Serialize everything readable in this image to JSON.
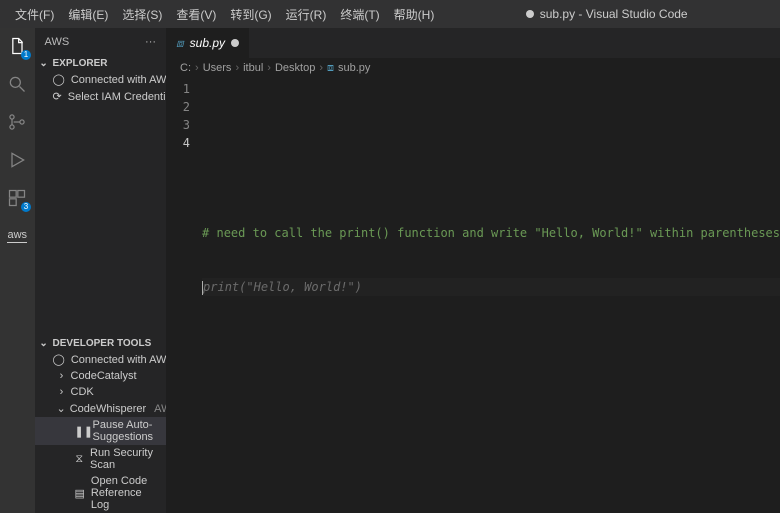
{
  "window": {
    "title": "sub.py - Visual Studio Code"
  },
  "menu": [
    "文件(F)",
    "编辑(E)",
    "选择(S)",
    "查看(V)",
    "转到(G)",
    "运行(R)",
    "终端(T)",
    "帮助(H)"
  ],
  "activitybar": {
    "explorer_badge": "1",
    "aws_badge": "3",
    "aws_label": "aws"
  },
  "sidebar": {
    "title": "AWS",
    "explorer": {
      "label": "EXPLORER",
      "items": [
        {
          "icon": "user",
          "label": "Connected with AWS Builder ID"
        },
        {
          "icon": "refresh",
          "label": "Select IAM Credentials to View Res..."
        }
      ]
    },
    "devtools": {
      "label": "DEVELOPER TOOLS",
      "connected": "Connected with AWS Builder ID",
      "children": [
        {
          "exp": ">",
          "label": "CodeCatalyst"
        },
        {
          "exp": ">",
          "label": "CDK"
        },
        {
          "exp": "v",
          "label": "CodeWhisperer",
          "suffix": "AWS Builder ID Conn..."
        }
      ],
      "cw": [
        {
          "icon": "pause",
          "label": "Pause Auto-Suggestions",
          "selected": true
        },
        {
          "icon": "scan",
          "label": "Run Security Scan"
        },
        {
          "icon": "log",
          "label": "Open Code Reference Log"
        }
      ]
    }
  },
  "tab": {
    "filename": "sub.py"
  },
  "breadcrumb": [
    "C:",
    "Users",
    "itbul",
    "Desktop",
    "sub.py"
  ],
  "editor": {
    "lines": [
      "1",
      "2",
      "3",
      "4"
    ],
    "comment": "# need to call the print() function and write \"Hello, World!\" within parentheses",
    "ghost": "print(\"Hello, World!\")"
  }
}
